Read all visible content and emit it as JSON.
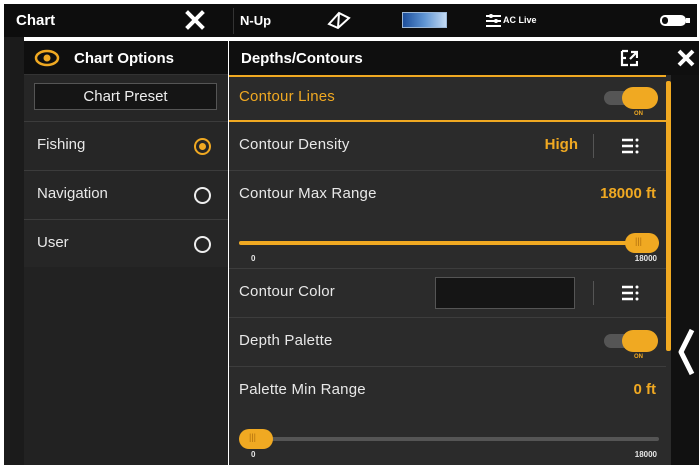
{
  "topbar": {
    "title": "Chart",
    "view_mode": "N-Up",
    "ac_live_label": "AC Live"
  },
  "chart_options": {
    "title": "Chart Options",
    "preset_label": "Chart Preset",
    "items": [
      {
        "label": "Fishing",
        "selected": true
      },
      {
        "label": "Navigation",
        "selected": false
      },
      {
        "label": "User",
        "selected": false
      }
    ]
  },
  "depths": {
    "title": "Depths/Contours",
    "contour_lines": {
      "label": "Contour Lines",
      "toggle": "ON"
    },
    "contour_density": {
      "label": "Contour Density",
      "value": "High"
    },
    "contour_max_range": {
      "label": "Contour Max Range",
      "value": "18000 ft",
      "slider_min": "0",
      "slider_max": "18000",
      "fraction": 1.0
    },
    "contour_color": {
      "label": "Contour Color"
    },
    "depth_palette": {
      "label": "Depth Palette",
      "toggle": "ON"
    },
    "palette_min_range": {
      "label": "Palette Min Range",
      "value": "0 ft",
      "slider_min": "0",
      "slider_max": "18000",
      "fraction": 0.0
    }
  },
  "colors": {
    "accent": "#f0a922",
    "panel": "#2b2b2b",
    "header": "#0f0f0f"
  },
  "icons": [
    "close-icon",
    "compass-icon",
    "ac-live-icon",
    "battery-icon",
    "eye-icon",
    "expand-icon",
    "menu-icon",
    "chevron-left-icon"
  ]
}
